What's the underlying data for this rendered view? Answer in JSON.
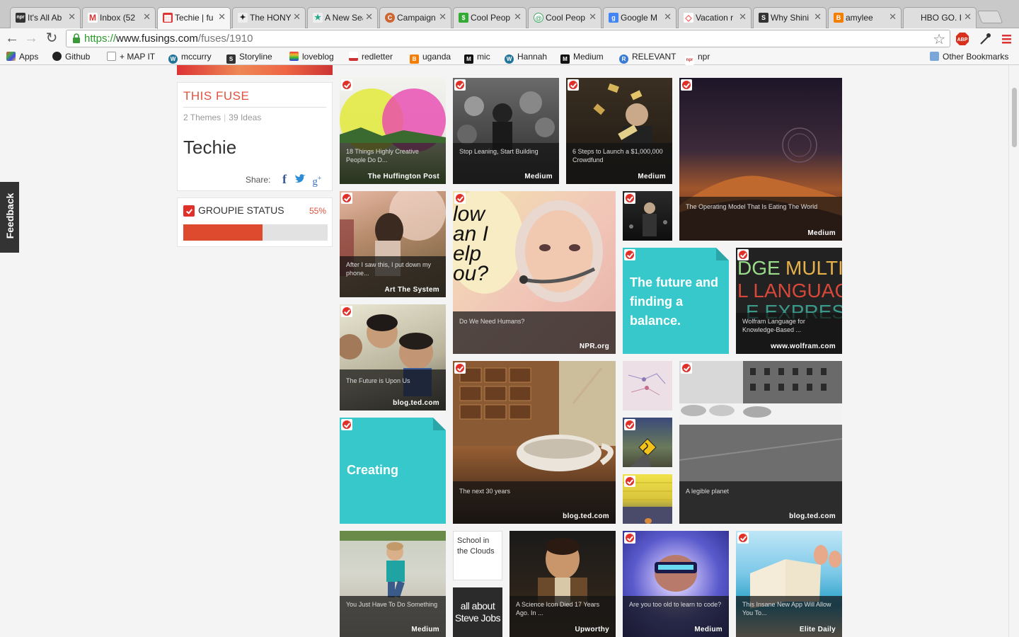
{
  "browser": {
    "tabs": [
      {
        "title": "It's All Ab",
        "favicon": "npr-icon",
        "color": "#333333"
      },
      {
        "title": "Inbox (52",
        "favicon": "gmail-icon",
        "color": "#d33"
      },
      {
        "title": "Techie | fu",
        "favicon": "fusings-icon",
        "color": "#d33"
      },
      {
        "title": "The HONY",
        "favicon": "hony-eagle-icon",
        "color": "#333"
      },
      {
        "title": "A New Sea",
        "favicon": "star-icon",
        "color": "#2a8"
      },
      {
        "title": "Campaign",
        "favicon": "campaign-icon",
        "color": "#c63"
      },
      {
        "title": "Cool Peop",
        "favicon": "dollar-icon",
        "color": "#3a3"
      },
      {
        "title": "Cool Peop",
        "favicon": "spiral-icon",
        "color": "#4a6"
      },
      {
        "title": "Google M",
        "favicon": "google-icon",
        "color": "#4285f4"
      },
      {
        "title": "Vacation r",
        "favicon": "airbnb-icon",
        "color": "#ff5a5f"
      },
      {
        "title": "Why Shini",
        "favicon": "squarespace-icon",
        "color": "#333"
      },
      {
        "title": "amylee",
        "favicon": "blogger-icon",
        "color": "#f57d00"
      },
      {
        "title": "HBO GO. I",
        "favicon": "",
        "color": "#999"
      }
    ],
    "url_scheme": "https://",
    "url_host": "www.fusings.com",
    "url_path": "/fuses/1910",
    "bookmarks": [
      {
        "label": "Apps",
        "icon": "apps-grid-icon",
        "color": "#e44"
      },
      {
        "label": "Github",
        "icon": "github-icon",
        "color": "#222"
      },
      {
        "label": "+ MAP IT",
        "icon": "page-icon",
        "color": "#bbb"
      },
      {
        "label": "mccurry",
        "icon": "wordpress-icon",
        "color": "#21759b"
      },
      {
        "label": "Storyline",
        "icon": "squarespace-icon",
        "color": "#333"
      },
      {
        "label": "loveblog",
        "icon": "rainbow-icon",
        "color": "#e94"
      },
      {
        "label": "redletter",
        "icon": "redletter-icon",
        "color": "#c33"
      },
      {
        "label": "uganda",
        "icon": "blogger-icon",
        "color": "#f57d00"
      },
      {
        "label": "mic",
        "icon": "mic-icon",
        "color": "#111"
      },
      {
        "label": "Hannah",
        "icon": "wordpress-icon",
        "color": "#21759b"
      },
      {
        "label": "Medium",
        "icon": "medium-icon",
        "color": "#111"
      },
      {
        "label": "RELEVANT",
        "icon": "relevant-icon",
        "color": "#3a7bd5"
      },
      {
        "label": "npr",
        "icon": "npr-icon",
        "color": "#c33"
      }
    ],
    "other_bookmarks": "Other Bookmarks"
  },
  "feedback": "Feedback",
  "fuse": {
    "label": "THIS FUSE",
    "themes": "2 Themes",
    "ideas": "39 Ideas",
    "title": "Techie",
    "share_label": "Share:"
  },
  "groupie": {
    "label": "GROUPIE STATUS",
    "percent_text": "55%",
    "fraction": 0.55
  },
  "tiles": [
    {
      "title": "18 Things Highly Creative People Do D...",
      "source": "The Huffington Post"
    },
    {
      "title": "Stop Leaning, Start Building",
      "source": "Medium"
    },
    {
      "title": "6 Steps to Launch a $1,000,000 Crowdfund",
      "source": "Medium"
    },
    {
      "title": "The Operating Model That Is Eating The World",
      "source": "Medium"
    },
    {
      "title": "After I saw this, I put down my phone...",
      "source": "Art The System"
    },
    {
      "title": "Do We Need Humans?",
      "source": "NPR.org"
    },
    {
      "title": "Wolfram Language for Knowledge-Based ...",
      "source": "www.wolfram.com"
    },
    {
      "title": "The Future is Upon Us",
      "source": "blog.ted.com"
    },
    {
      "title": "The next 30 years",
      "source": "blog.ted.com"
    },
    {
      "title": "A legible planet",
      "source": "blog.ted.com"
    },
    {
      "title": "You Just Have To Do Something",
      "source": "Medium"
    },
    {
      "title": "A Science Icon Died 17 Years Ago. In ...",
      "source": "Upworthy"
    },
    {
      "title": "Are you too old to learn to code?",
      "source": "Medium"
    },
    {
      "title": "This Insane New App Will Allow You To...",
      "source": "Elite Daily"
    }
  ],
  "notes": {
    "future": "The future and finding a balance.",
    "creating": "Creating",
    "school": "School in the Clouds",
    "jobs": "all about Steve Jobs"
  },
  "image_text": {
    "robot_headline": "low an I elp ou?",
    "wolfram_words": "DGE MULTI L LANGUAGE"
  }
}
